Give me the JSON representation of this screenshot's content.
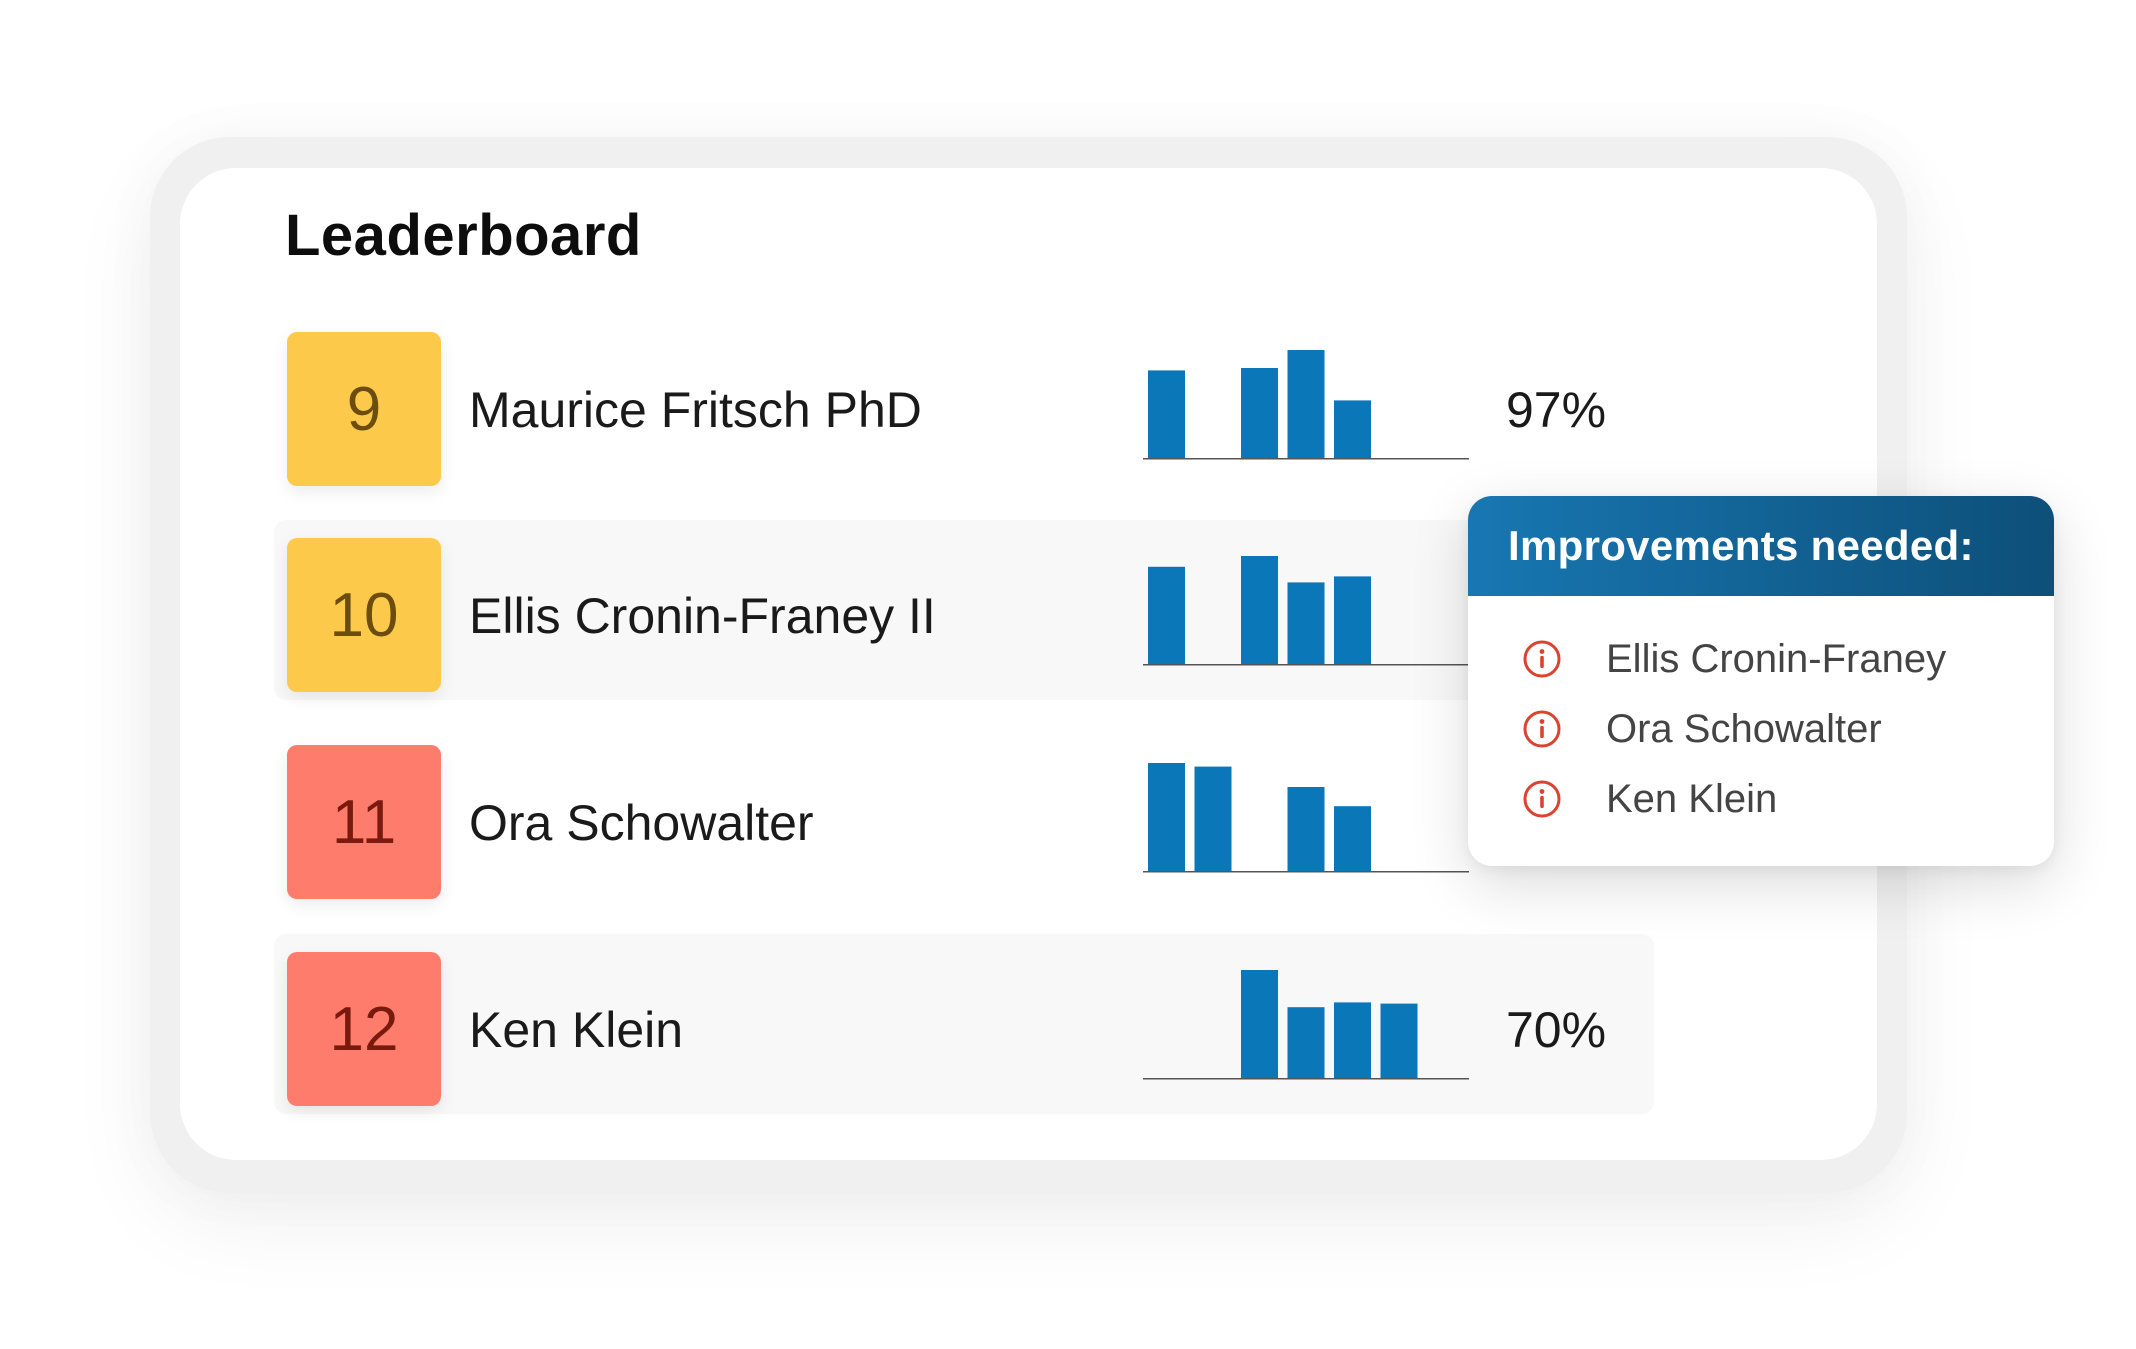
{
  "leaderboard": {
    "title": "Leaderboard",
    "rows": [
      {
        "rank": "9",
        "name": "Maurice Fritsch PhD",
        "percent": "97%",
        "badge_color": "#fdc94b",
        "trend": [
          73,
          0,
          75,
          90,
          48,
          0
        ]
      },
      {
        "rank": "10",
        "name": "Ellis Cronin-Franey II",
        "percent": "",
        "badge_color": "#fdc94b",
        "trend": [
          81,
          0,
          90,
          68,
          73,
          0
        ]
      },
      {
        "rank": "11",
        "name": "Ora Schowalter",
        "percent": "",
        "badge_color": "#fd7c6c",
        "trend": [
          90,
          87,
          0,
          70,
          54,
          0
        ]
      },
      {
        "rank": "12",
        "name": "Ken Klein",
        "percent": "70%",
        "badge_color": "#fd7c6c",
        "trend": [
          0,
          0,
          90,
          59,
          63,
          62
        ]
      }
    ],
    "bar_color": "#0a77b9"
  },
  "popup": {
    "title": "Improvements needed:",
    "icon": "info-circle-icon",
    "icon_color": "#d9432f",
    "items": [
      {
        "name": "Ellis Cronin-Franey"
      },
      {
        "name": "Ora Schowalter"
      },
      {
        "name": "Ken Klein"
      }
    ]
  }
}
